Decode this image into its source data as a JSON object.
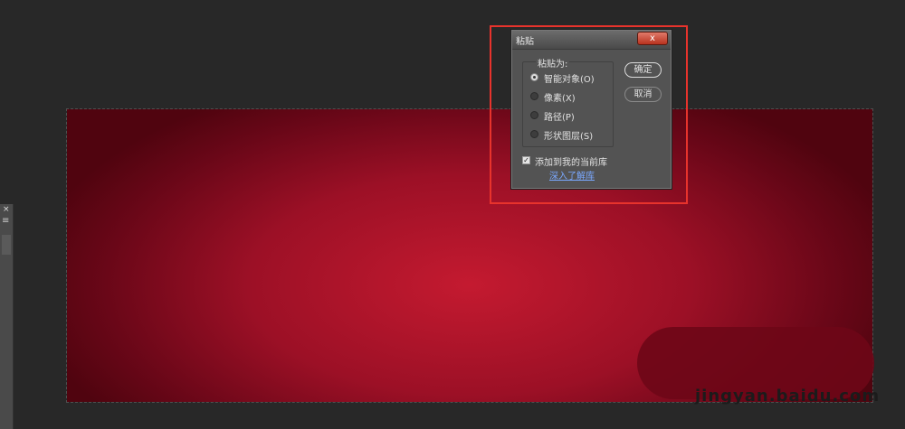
{
  "dialog": {
    "title": "粘贴",
    "close_glyph": "x",
    "group_label": "粘贴为:",
    "options": [
      {
        "label": "智能对象(O)",
        "checked": true
      },
      {
        "label": "像素(X)",
        "checked": false
      },
      {
        "label": "路径(P)",
        "checked": false
      },
      {
        "label": "形状图层(S)",
        "checked": false
      }
    ],
    "ok_label": "确定",
    "cancel_label": "取消",
    "checkbox_label": "添加到我的当前库",
    "checkbox_checked": true,
    "link_label": "深入了解库"
  },
  "left_panel": {
    "close_glyph": "×",
    "menu_glyph": "≡"
  },
  "watermark": {
    "text": "jingyan.baidu.com"
  },
  "colors": {
    "workspace": "#282828",
    "canvas_center": "#c41a30",
    "canvas_edge": "#50040f",
    "dialog_bg": "#535353",
    "highlight": "#e8332c",
    "link": "#7aa8ff"
  }
}
